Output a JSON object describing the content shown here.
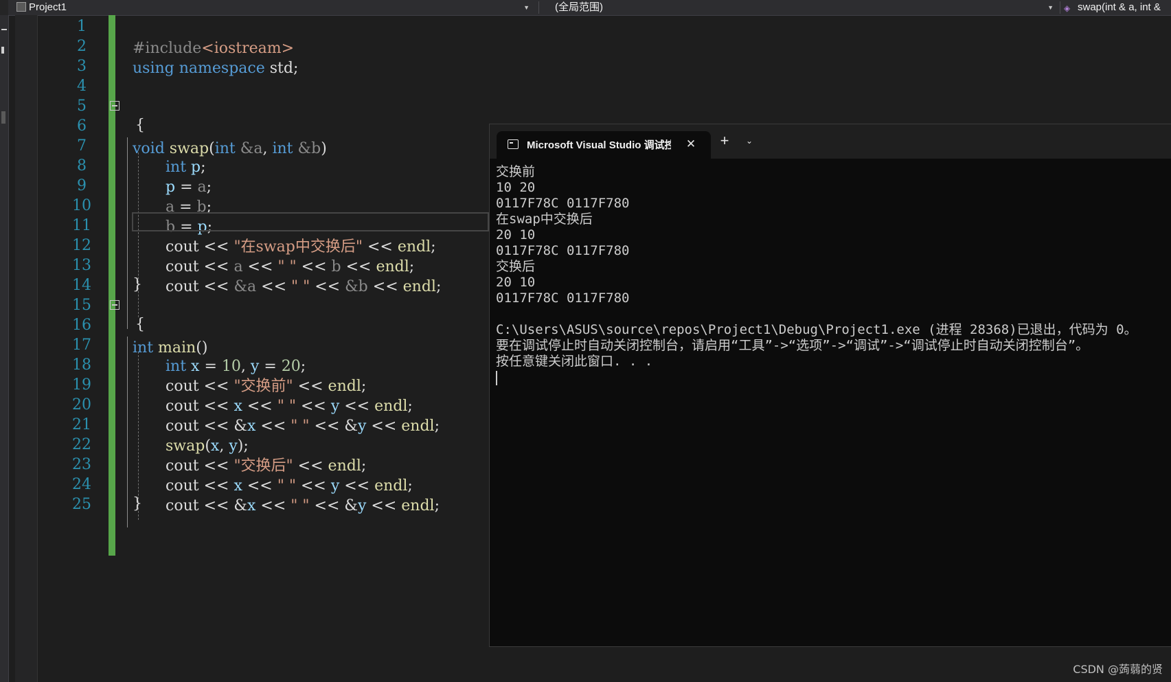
{
  "navbar": {
    "project": "Project1",
    "scope": "(全局范围)",
    "member": "swap(int & a, int &"
  },
  "editor": {
    "line_numbers": [
      "1",
      "2",
      "3",
      "4",
      "5",
      "6",
      "7",
      "8",
      "9",
      "10",
      "11",
      "12",
      "13",
      "14",
      "15",
      "16",
      "17",
      "18",
      "19",
      "20",
      "21",
      "22",
      "23",
      "24",
      "25"
    ],
    "code": {
      "l1_directive": "#include",
      "l1_header": "<iostream>",
      "l2_using": "using",
      "l2_namespace": "namespace",
      "l2_rest": " std;",
      "void_kw": "void",
      "swap_fn": "swap",
      "int_kw": "int",
      "p_var": "p",
      "main_fn": "main",
      "str_after_swap": "\"在swap中交换后\"",
      "str_before": "\"交换前\"",
      "str_after": "\"交换后\"",
      "str_space": "\" \"",
      "num_10": "10",
      "num_20": "20"
    }
  },
  "console": {
    "tab_title": "Microsoft Visual Studio 调试控制台",
    "close_glyph": "✕",
    "add_glyph": "+",
    "dropdown_glyph": "⌄",
    "lines": [
      "交换前",
      "10 20",
      "0117F78C 0117F780",
      "在swap中交换后",
      "20 10",
      "0117F78C 0117F780",
      "交换后",
      "20 10",
      "0117F78C 0117F780",
      "",
      "C:\\Users\\ASUS\\source\\repos\\Project1\\Debug\\Project1.exe (进程 28368)已退出，代码为 0。",
      "要在调试停止时自动关闭控制台，请启用“工具”->“选项”->“调试”->“调试停止时自动关闭控制台”。",
      "按任意键关闭此窗口. . ."
    ]
  },
  "watermark": "CSDN @蒟蒻的贤"
}
